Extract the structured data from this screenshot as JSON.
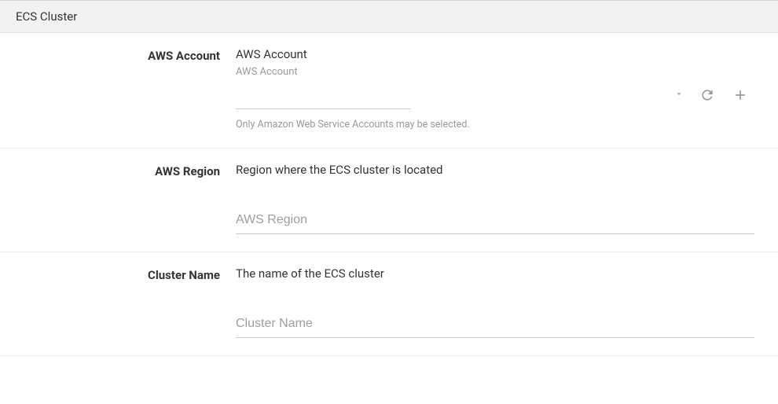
{
  "section": {
    "title": "ECS Cluster"
  },
  "fields": {
    "aws_account": {
      "label": "AWS Account",
      "description": "AWS Account",
      "sublabel": "AWS Account",
      "hint": "Only Amazon Web Service Accounts may be selected.",
      "value": ""
    },
    "aws_region": {
      "label": "AWS Region",
      "description": "Region where the ECS cluster is located",
      "placeholder": "AWS Region",
      "value": ""
    },
    "cluster_name": {
      "label": "Cluster Name",
      "description": "The name of the ECS cluster",
      "placeholder": "Cluster Name",
      "value": ""
    }
  }
}
